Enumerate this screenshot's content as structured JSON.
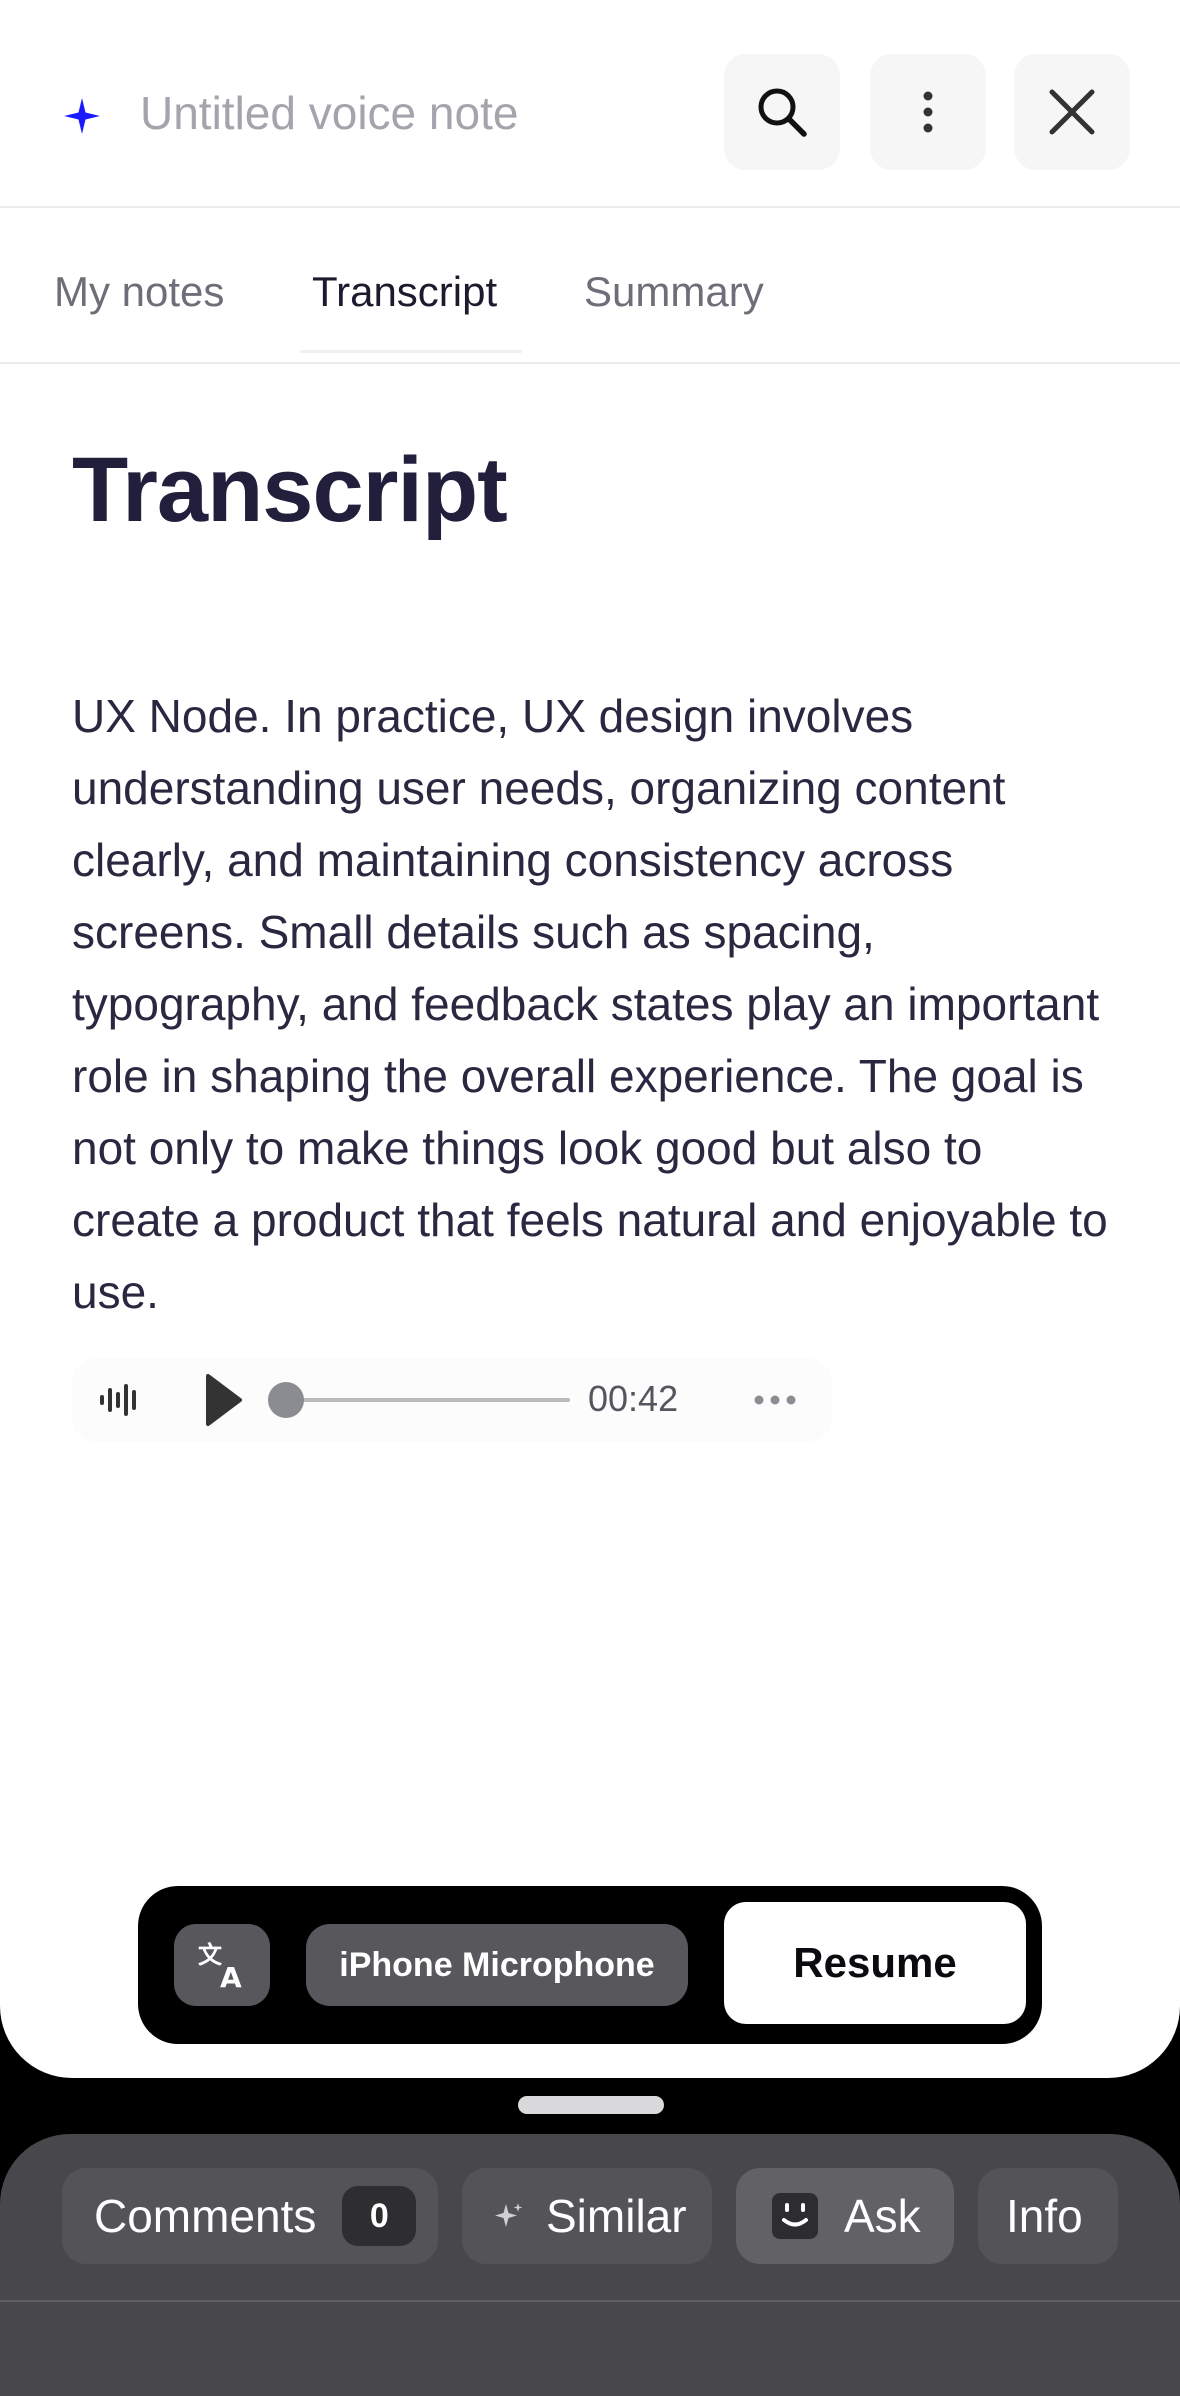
{
  "header": {
    "title_placeholder": "Untitled voice note",
    "icons": [
      "sparkle-icon",
      "search-icon",
      "more-vertical-icon",
      "close-icon"
    ],
    "accent_color": "#1a1aff"
  },
  "tabs": [
    {
      "label": "My notes",
      "active": false
    },
    {
      "label": "Transcript",
      "active": true
    },
    {
      "label": "Summary",
      "active": false
    }
  ],
  "document": {
    "title": "Transcript",
    "body": "UX Node. In practice, UX design involves understanding user needs, organizing content clearly, and maintaining consistency across screens. Small details such as spacing, typography, and feedback states play an important role in shaping the overall experience. The goal is not only to make things look good but also to create a product that feels natural and enjoyable to use."
  },
  "player": {
    "duration": "00:42",
    "progress": 0,
    "icons": [
      "waveform-icon",
      "play-icon",
      "more-horizontal-icon"
    ]
  },
  "recording_bar": {
    "translate_icon": "translate-icon",
    "microphone_label": "iPhone Microphone",
    "resume_label": "Resume"
  },
  "bottom_bar": {
    "comments_label": "Comments",
    "comments_count": "0",
    "similar_label": "Similar",
    "ask_label": "Ask",
    "info_label": "Info"
  }
}
